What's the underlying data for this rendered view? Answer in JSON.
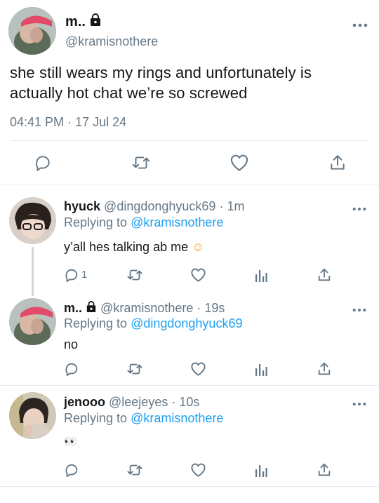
{
  "colors": {
    "accent": "#1da1f2",
    "text": "#14171a",
    "muted": "#657786",
    "divider": "#e6ecf0"
  },
  "main_tweet": {
    "display_name": "m..",
    "handle": "@kramisnothere",
    "locked": true,
    "text": "she still wears my rings and unfortunately is actually hot chat we’re so screwed",
    "time": "04:41 PM",
    "separator": "·",
    "date": "17 Jul 24",
    "more_icon": "more-horizontal-icon",
    "actions": [
      "reply-icon",
      "retweet-icon",
      "like-icon",
      "share-icon"
    ]
  },
  "replies": [
    {
      "display_name": "hyuck",
      "handle": "@dingdonghyuck69",
      "separator": "·",
      "age": "1m",
      "replying_label": "Replying to",
      "replying_to": "@kramisnothere",
      "text": "y’all hes talking ab me",
      "emoji": "☺",
      "reply_count": "1",
      "locked": false,
      "actions": [
        "reply-icon",
        "retweet-icon",
        "like-icon",
        "analytics-icon",
        "share-icon"
      ]
    },
    {
      "display_name": "m..",
      "handle": "@kramisnothere",
      "separator": "·",
      "age": "19s",
      "replying_label": "Replying to",
      "replying_to": "@dingdonghyuck69",
      "text": "no",
      "reply_count": "",
      "locked": true,
      "actions": [
        "reply-icon",
        "retweet-icon",
        "like-icon",
        "analytics-icon",
        "share-icon"
      ]
    },
    {
      "display_name": "jenooo",
      "handle": "@leejeyes",
      "separator": "·",
      "age": "10s",
      "replying_label": "Replying to",
      "replying_to": "@kramisnothere",
      "text": "👀",
      "reply_count": "",
      "locked": false,
      "actions": [
        "reply-icon",
        "retweet-icon",
        "like-icon",
        "analytics-icon",
        "share-icon"
      ]
    }
  ]
}
